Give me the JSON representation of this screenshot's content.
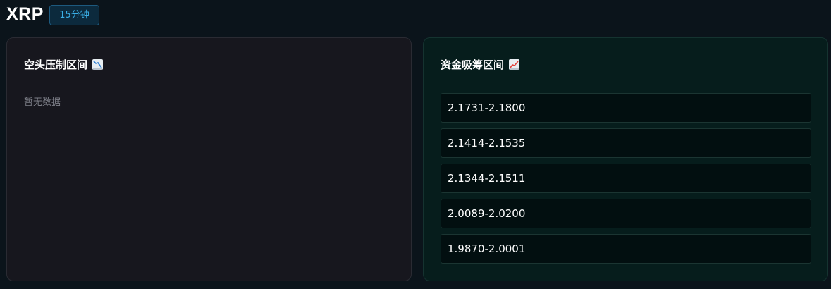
{
  "header": {
    "symbol": "XRP",
    "interval": "15分钟"
  },
  "short_panel": {
    "title": "空头压制区间",
    "icon": "chart-decreasing-icon",
    "empty_text": "暂无数据"
  },
  "long_panel": {
    "title": "资金吸筹区间",
    "icon": "chart-increasing-icon",
    "zones": [
      "2.1731-2.1800",
      "2.1414-2.1535",
      "2.1344-2.1511",
      "2.0089-2.0200",
      "1.9870-2.0001"
    ]
  },
  "colors": {
    "background": "#0b141b",
    "short_panel_bg": "#17171e",
    "long_panel_bg": "#061d1c",
    "badge_accent": "#3aaee5",
    "decrease": "#2f7fd1",
    "increase": "#e0403a"
  }
}
